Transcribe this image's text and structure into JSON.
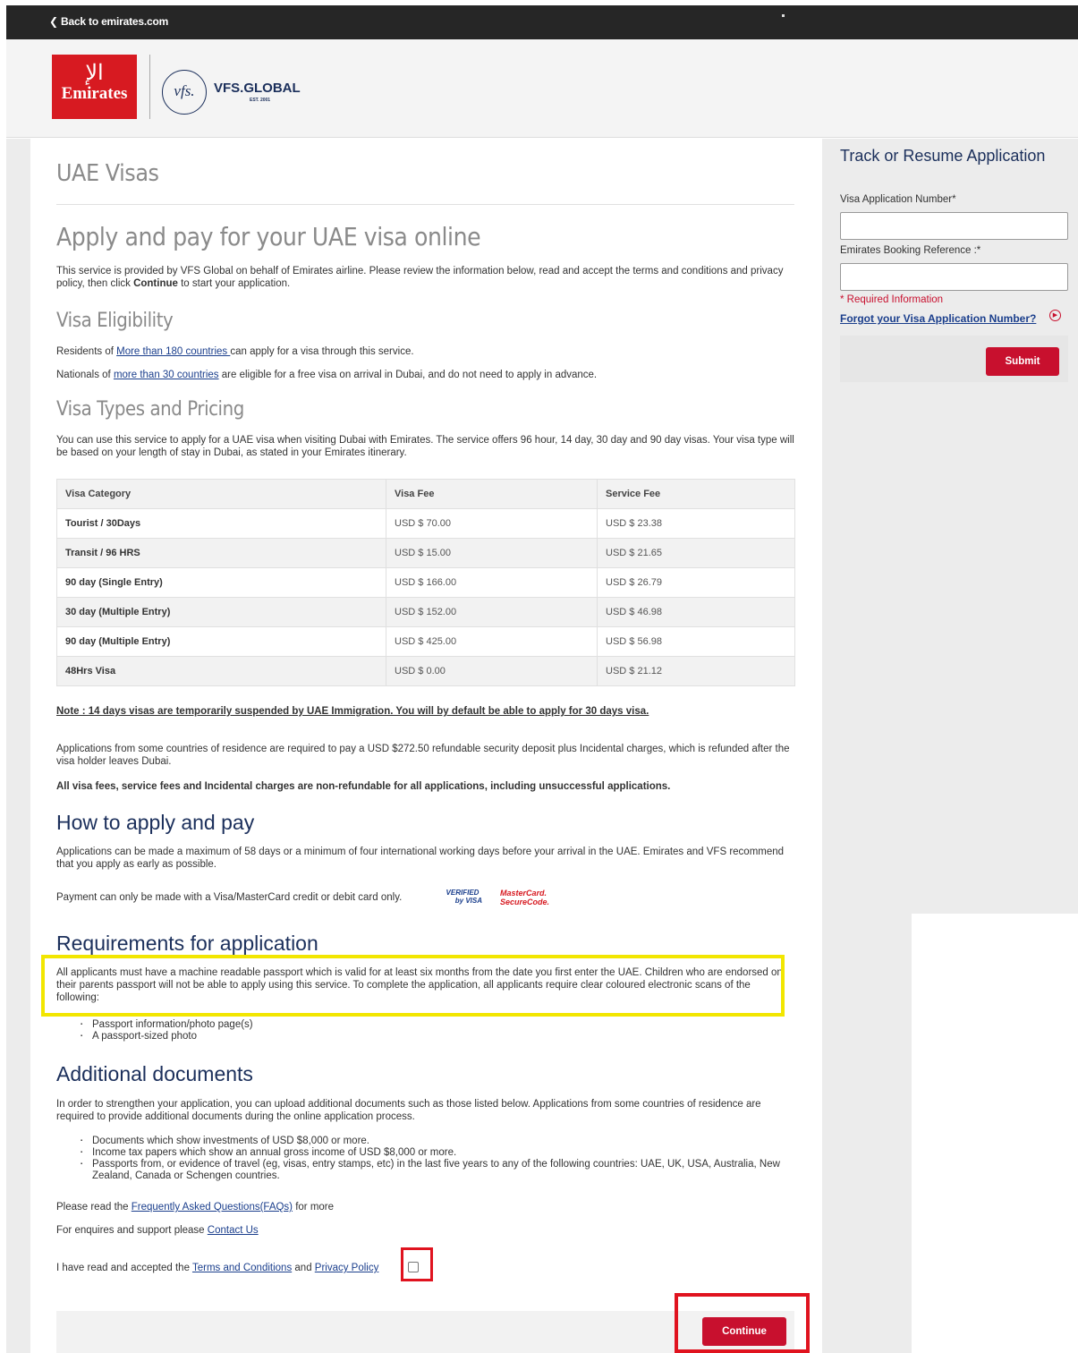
{
  "topbar": {
    "back_label": "Back to emirates.com"
  },
  "logos": {
    "emirates_wordmark": "Emirates",
    "vfs_mark": "vfs.",
    "vfs_name": "VFS.GLOBAL",
    "vfs_est": "EST. 2001"
  },
  "main": {
    "title": "UAE Visas",
    "headline": "Apply and pay for your UAE visa online",
    "intro_pre": "This service is provided by VFS Global on behalf of Emirates airline. Please review the information below, read and accept the terms and conditions and privacy policy, then click ",
    "intro_bold": "Continue",
    "intro_post": " to start your application.",
    "eligibility": {
      "heading": "Visa Eligibility",
      "line1_pre": "Residents of ",
      "line1_link": "More than 180 countries ",
      "line1_post": "can apply for a visa through this service.",
      "line2_pre": "Nationals of ",
      "line2_link": "more than 30 countries",
      "line2_post": " are eligible for a free visa on arrival in Dubai, and do not need to apply in advance."
    },
    "pricing": {
      "heading": "Visa Types and Pricing",
      "text": "You can use this service to apply for a UAE visa when visiting Dubai with Emirates. The service offers 96 hour, 14 day, 30 day and 90 day visas. Your visa type will be based on your length of stay in Dubai, as stated in your Emirates itinerary.",
      "columns": [
        "Visa Category",
        "Visa Fee",
        "Service Fee"
      ],
      "rows": [
        [
          "Tourist / 30Days",
          "USD $ 70.00",
          "USD $ 23.38"
        ],
        [
          "Transit / 96 HRS",
          "USD $ 15.00",
          "USD $ 21.65"
        ],
        [
          "90 day (Single Entry)",
          "USD $ 166.00",
          "USD $ 26.79"
        ],
        [
          "30 day (Multiple Entry)",
          "USD $ 152.00",
          "USD $ 46.98"
        ],
        [
          "90 day (Multiple Entry)",
          "USD $ 425.00",
          "USD $ 56.98"
        ],
        [
          "48Hrs Visa",
          "USD $ 0.00",
          "USD $ 21.12"
        ]
      ],
      "note": "Note : 14 days visas are temporarily suspended by UAE Immigration. You will by default be able to apply for 30 days visa.",
      "deposit_text": "Applications from some countries of residence are required to pay a USD $272.50 refundable security deposit plus Incidental charges, which is refunded after the visa holder leaves Dubai.",
      "nonrefund_text": "All visa fees, service fees and Incidental charges are non-refundable for all applications, including unsuccessful applications."
    },
    "how": {
      "heading": "How to apply and pay",
      "text": "Applications can be made a maximum of 58 days or a minimum of four international working days before your arrival in the UAE. Emirates and VFS recommend that you apply as early as possible.",
      "payment_text": "Payment can only be made with a Visa/MasterCard credit or debit card only.",
      "vbv_line1": "VERIFIED",
      "vbv_line2": "by VISA",
      "msc_line1": "MasterCard.",
      "msc_line2": "SecureCode."
    },
    "requirements": {
      "heading": "Requirements for application",
      "text": "All applicants must have a machine readable passport which is valid for at least six months from the date you first enter the UAE. Children who are endorsed on their parents passport will not be able to apply using this service. To complete the application, all applicants require clear coloured electronic scans of the following:",
      "items": [
        "Passport information/photo page(s)",
        "A passport-sized photo"
      ]
    },
    "additional": {
      "heading": "Additional documents",
      "text": "In order to strengthen your application, you can upload additional documents such as those listed below. Applications from some countries of residence are required to provide additional documents during the online application process.",
      "items": [
        "Documents which show investments of USD $8,000 or more.",
        "Income tax papers which show an annual gross income of USD $8,000 or more.",
        "Passports from, or evidence of travel (eg, visas, entry stamps, etc) in the last five years to any of the following countries: UAE, UK, USA, Australia, New Zealand, Canada or Schengen countries."
      ],
      "faq_pre": "Please read the ",
      "faq_link": "Frequently Asked Questions(FAQs)",
      "faq_post": " for more",
      "support_pre": "For enquires and support please ",
      "support_link": "Contact Us"
    },
    "consent": {
      "pre": "I have read and accepted the ",
      "terms_link": "Terms and Conditions",
      "and": " and ",
      "privacy_link": "Privacy Policy"
    },
    "continue_label": "Continue"
  },
  "sidebar": {
    "title": "Track or Resume Application",
    "visa_number_label": "Visa Application Number*",
    "visa_number_value": "",
    "booking_label": "Emirates Booking Reference :*",
    "booking_value": "",
    "required_info": "* Required Information",
    "forgot_link": "Forgot your Visa Application Number?",
    "submit_label": "Submit"
  }
}
